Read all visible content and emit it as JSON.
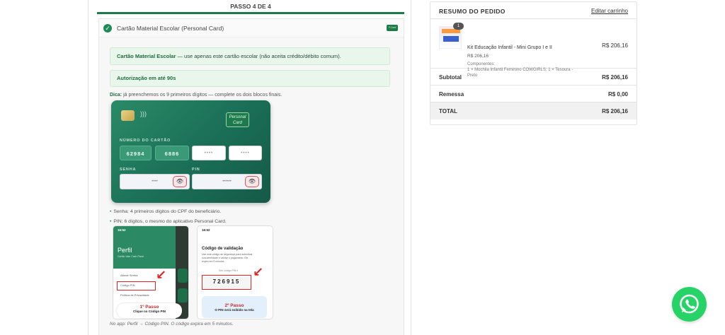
{
  "checkout": {
    "step_label": "PASSO 4 DE 4",
    "payment_method": "Cartão Material Escolar (Personal Card)",
    "note_title": "Cartão Material Escolar",
    "note_text": " — use apenas este cartão escolar (não aceita crédito/débito comum).",
    "authorization": "Autorização em até 90s",
    "tip_label": "Dica:",
    "tip_text": " já preenchemos os 9 primeiros dígitos — complete os dois blocos finais.",
    "card": {
      "logo_line1": "Personal",
      "logo_line2": "Card",
      "number_label": "NÚMERO DO CARTÃO",
      "block1": "62984",
      "block2": "6886",
      "block3_placeholder": "••••",
      "block4_placeholder": "••••",
      "senha_label": "SENHA",
      "senha_placeholder": "••••",
      "pin_label": "PIN",
      "pin_placeholder": "••••••"
    },
    "bullet_senha": "Senha: 4 primeiros dígitos do CPF do beneficiário.",
    "bullet_pin": "PIN: 6 dígitos, o mesmo do aplicativo Personal Card.",
    "app_screens": {
      "time": "16:52",
      "profile_title": "Perfil",
      "profile_sub": "Cartão Vale Cash Flash",
      "menu_1": "Alterar Senha",
      "menu_2": "Código PIN",
      "menu_3": "Política de Privacidade",
      "step1_title": "1º Passo",
      "step1_text": "Clique no Código PIN",
      "validation_title": "Código de validação",
      "validation_text": "Use este código de segurança para autenticar sua identidade e validar o pagamento. Ele expira em 5 minutos.",
      "pin_label": "Seu código PIN é",
      "pin_code": "726915",
      "step2_title": "2º Passo",
      "step2_text": "O PIN será exibido na tela"
    },
    "footer_note": "No app: Perfil → Código PIN. O código expira em 5 minutos."
  },
  "summary": {
    "title": "RESUMO DO PEDIDO",
    "edit_link": "Editar carrinho",
    "product": {
      "qty": "1",
      "name": "Kit Educação Infantil - Mini Grupo I e II",
      "unit_price": "R$ 206,16",
      "components_label": "Componentes:",
      "components": "1 × Mochila Infantil Feminino COWGIRLS; 1 × Tesoura - Preto",
      "price": "R$ 206,16"
    },
    "subtotal_label": "Subtotal",
    "subtotal": "R$ 206,16",
    "shipping_label": "Remessa",
    "shipping": "R$ 0,00",
    "total_label": "TOTAL",
    "total": "R$ 206,16"
  },
  "colors": {
    "brand_green": "#1f7a4a",
    "whatsapp": "#25d366",
    "alert_red": "#e02424"
  }
}
